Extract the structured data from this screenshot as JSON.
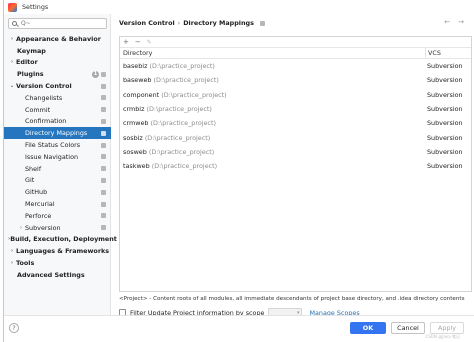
{
  "window": {
    "title": "Settings"
  },
  "search": {
    "placeholder": "Q~"
  },
  "sidebar": {
    "items": [
      {
        "label": "Appearance & Behavior",
        "level": 0,
        "arrow": "›"
      },
      {
        "label": "Keymap",
        "level": 0
      },
      {
        "label": "Editor",
        "level": 0,
        "arrow": "›"
      },
      {
        "label": "Plugins",
        "level": 0,
        "badge": "1"
      },
      {
        "label": "Version Control",
        "level": 0,
        "arrow": "⌄"
      },
      {
        "label": "Changelists",
        "level": 1
      },
      {
        "label": "Commit",
        "level": 1
      },
      {
        "label": "Confirmation",
        "level": 1
      },
      {
        "label": "Directory Mappings",
        "level": 1,
        "selected": true
      },
      {
        "label": "File Status Colors",
        "level": 1
      },
      {
        "label": "Issue Navigation",
        "level": 1
      },
      {
        "label": "Shelf",
        "level": 1
      },
      {
        "label": "Git",
        "level": 1
      },
      {
        "label": "GitHub",
        "level": 1
      },
      {
        "label": "Mercurial",
        "level": 1
      },
      {
        "label": "Perforce",
        "level": 1
      },
      {
        "label": "Subversion",
        "level": 1,
        "arrow": "›"
      },
      {
        "label": "Build, Execution, Deployment",
        "level": 0,
        "arrow": "›"
      },
      {
        "label": "Languages & Frameworks",
        "level": 0,
        "arrow": "›"
      },
      {
        "label": "Tools",
        "level": 0,
        "arrow": "›"
      },
      {
        "label": "Advanced Settings",
        "level": 0
      }
    ]
  },
  "breadcrumb": {
    "parent": "Version Control",
    "separator": "›",
    "current": "Directory Mappings"
  },
  "nav": {
    "back": "←",
    "forward": "→"
  },
  "toolbar": {
    "add": "+",
    "remove": "−",
    "edit": "✎"
  },
  "table": {
    "headers": {
      "directory": "Directory",
      "vcs": "VCS"
    },
    "rows": [
      {
        "name": "basebiz",
        "path": "(D:\\practice_project)",
        "vcs": "Subversion"
      },
      {
        "name": "baseweb",
        "path": "(D:\\practice_project)",
        "vcs": "Subversion"
      },
      {
        "name": "component",
        "path": "(D:\\practice_project)",
        "vcs": "Subversion"
      },
      {
        "name": "crmbiz",
        "path": "(D:\\practice_project)",
        "vcs": "Subversion"
      },
      {
        "name": "crmweb",
        "path": "(D:\\practice_project)",
        "vcs": "Subversion"
      },
      {
        "name": "sosbiz",
        "path": "(D:\\practice_project)",
        "vcs": "Subversion"
      },
      {
        "name": "sosweb",
        "path": "(D:\\practice_project)",
        "vcs": "Subversion"
      },
      {
        "name": "taskweb",
        "path": "(D:\\practice_project)",
        "vcs": "Subversion"
      }
    ]
  },
  "info": "<Project> - Content roots of all modules, all immediate descendants of project base directory, and .idea directory contents",
  "filter": {
    "label": "Filter Update Project information by scope",
    "checked": false,
    "scope_value": "",
    "manage_label": "Manage Scopes"
  },
  "footer": {
    "help": "?",
    "ok": "OK",
    "cancel": "Cancel",
    "apply": "Apply",
    "watermark": "CSDN @Java 笔记"
  },
  "colors": {
    "accent": "#3574f0",
    "selection": "#2675bf",
    "link": "#2470b3"
  }
}
